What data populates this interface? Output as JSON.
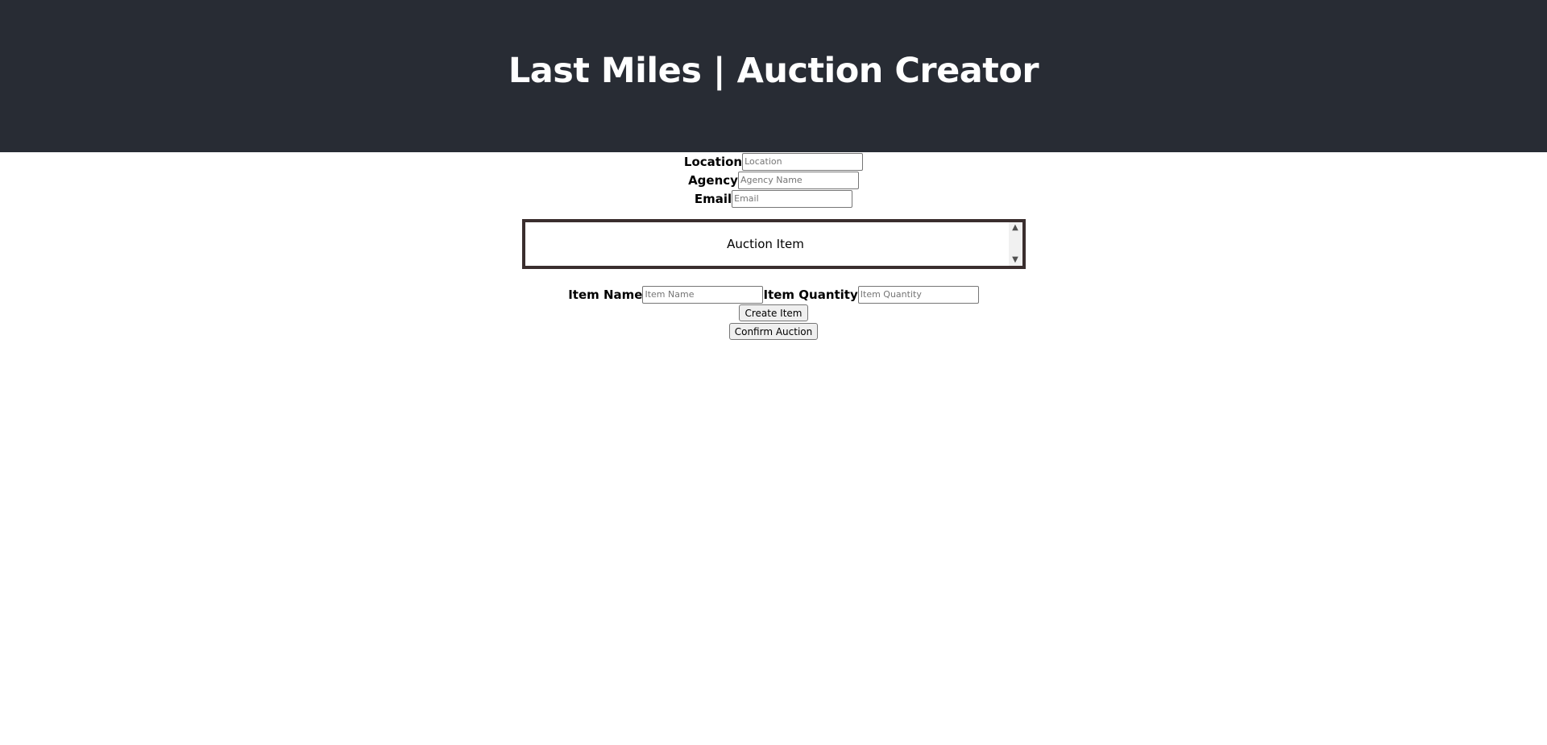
{
  "header": {
    "title": "Last Miles | Auction Creator",
    "background": "#282c34"
  },
  "form": {
    "location": {
      "label": "Location",
      "placeholder": "Location",
      "value": ""
    },
    "agency": {
      "label": "Agency",
      "placeholder": "Agency Name",
      "value": ""
    },
    "email": {
      "label": "Email",
      "placeholder": "Email",
      "value": ""
    }
  },
  "auction_list": {
    "items": [
      "Auction Item"
    ],
    "border_color": "#3a2e2e",
    "scroll_up_icon": "chevron-up-icon",
    "scroll_down_icon": "chevron-down-icon"
  },
  "item_form": {
    "name": {
      "label": "Item Name",
      "placeholder": "Item Name",
      "value": ""
    },
    "quantity": {
      "label": "Item Quantity",
      "placeholder": "Item Quantity",
      "value": ""
    },
    "create_label": "Create Item",
    "confirm_label": "Confirm Auction"
  }
}
